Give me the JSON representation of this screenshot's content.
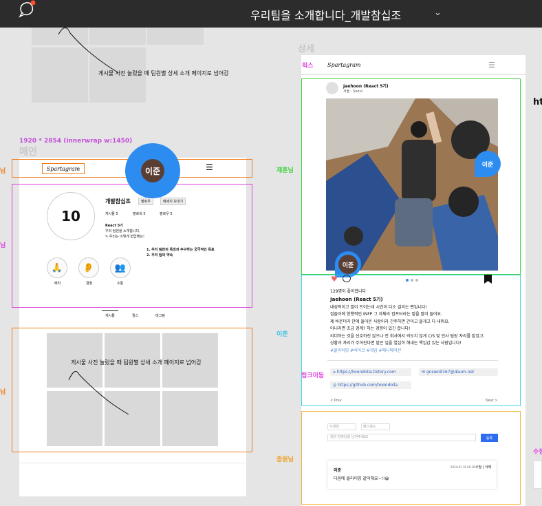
{
  "topbar": {
    "title": "우리팀을 소개합니다_개발참십조",
    "chevron": "⌄",
    "icon": "comment-icon"
  },
  "main_section": {
    "spec_label": "1920 * 2854 (innerwrap w:1450)",
    "section_title": "메인",
    "logo": "Spartagram",
    "menu_icon": "☰",
    "top_annotation": "게시물 사진 눌렀을 때 팀원별 상세 소개 페이지로 넘어감",
    "left_labels": [
      "님",
      "님",
      "님"
    ],
    "profile": {
      "avatar_number": "10",
      "team_name": "개발참십조",
      "follow_btn": "팔로우",
      "message_btn": "메세지 보내기",
      "stats": [
        "게시물 5",
        "팔로워 5",
        "팔로우 5"
      ],
      "bio_title": "React 5기",
      "bio_line1": "우리 팀원을 소개합니다.",
      "bio_line2": "✎ 우리는 이렇게 협업해요!",
      "goals": [
        "1. 우리 팀만의 특징과 추구하는 궁극적인 목표",
        "2. 우리 팀의 약속"
      ],
      "highlights": [
        {
          "label": "배려",
          "icon": "🙏"
        },
        {
          "label": "경청",
          "icon": "👂"
        },
        {
          "label": "소통",
          "icon": "👥"
        }
      ]
    },
    "tabs": [
      "게시물",
      "릴스",
      "태그됨"
    ],
    "grid_annotation": "게시물 사진 눌렀을 때 팀원별 상세 소개 페이지로 넘어감",
    "cursor_name": "이준"
  },
  "detail_section": {
    "section_title": "상세",
    "fixed_label": "픽스",
    "logo": "Spartagram",
    "menu_icon": "☰",
    "labels": {
      "green": "재훈님",
      "cyan": "이준",
      "link": "링크이동",
      "gold": "종원님",
      "right_partial": "ht",
      "right_partial2": "수정"
    },
    "post": {
      "author": "Jaehoon (React 5기)",
      "location": "서울 - Seoul",
      "likes": "129명이 좋아합니다",
      "headline": "Jaehoon (React 5기)",
      "lines": [
        "내성적이고 말이 트이는데 시간이 다소 걸리는 편입니다!",
        "집돌이에 현행적인 INFP 그 자체라 컴프터라는 말을 많이 들어요.",
        "제 바운더리 안에 들어온 사람이라 간주하면 간이고 쓸개고 다 내줘요.",
        "아니라면 조금 경계? 하는 경향이 있긴 합니다!",
        "리더하는 것을 선호하진 않으나 전 회사에서 의도치 않게 C/S 및 인사 팀장 자리를 맡았고,",
        "상황과 자리가 주어진다면 맡은 일을 열심히 해내는 책임감 있는 사람입니다!"
      ],
      "tags": "#클라이밍 #바이크 #게임 #애니메이션",
      "links": [
        "https://hoondolla.tistory.com",
        "https://github.com/hoondolla"
      ],
      "email": "gnswo9167@daum.net",
      "prev": "< Prev",
      "next": "Next >"
    },
    "comment_form": {
      "name_placeholder": "닉네임",
      "pw_placeholder": "패스워드",
      "content_placeholder": "응원 한마디를 남겨주세요!",
      "submit": "등록"
    },
    "comment": {
      "author": "이준",
      "meta": "2024.01.16 09:16",
      "actions": "수정 | 삭제",
      "text": "다음에 클라이밍 같이해요~!!😀"
    },
    "cursor_name_1": "이준",
    "cursor_name_2": "이준"
  },
  "colors": {
    "orange": "#f07c1a",
    "pink": "#e040e0",
    "green": "#41d341",
    "cyan": "#3ed6e8",
    "gold": "#f0b640",
    "cursor": "#2d8cf0"
  }
}
